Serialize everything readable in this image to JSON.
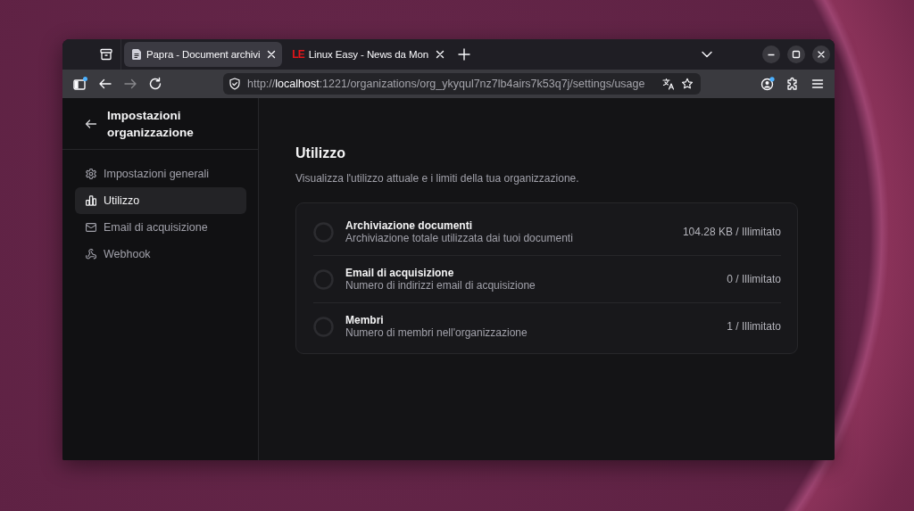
{
  "browser": {
    "tabs": [
      {
        "title": "Papra - Document archivi",
        "selected": true
      },
      {
        "logo_text": "LE",
        "title": "Linux Easy - News da Mon",
        "selected": false
      }
    ],
    "toolbar": {
      "forward_disabled": true,
      "address": "http://**localhost**:1221/organizations/org_ykyqul7nz7lb4airs7k53q7j/settings/usage"
    }
  },
  "sidebar": {
    "title": "Impostazioni organizzazione",
    "items": [
      {
        "label": "Impostazioni generali",
        "selected": false
      },
      {
        "label": "Utilizzo",
        "selected": true
      },
      {
        "label": "Email di acquisizione",
        "selected": false
      },
      {
        "label": "Webhook",
        "selected": false
      }
    ]
  },
  "main": {
    "title": "Utilizzo",
    "description": "Visualizza l'utilizzo attuale e i limiti della tua organizzazione.",
    "usage": [
      {
        "name": "Archiviazione documenti",
        "description": "Archiviazione totale utilizzata dai tuoi documenti",
        "value": "104.28 KB / Illimitato"
      },
      {
        "name": "Email di acquisizione",
        "description": "Numero di indirizzi email di acquisizione",
        "value": "0 / Illimitato"
      },
      {
        "name": "Membri",
        "description": "Numero di membri nell'organizzazione",
        "value": "1 / Illimitato"
      }
    ]
  }
}
